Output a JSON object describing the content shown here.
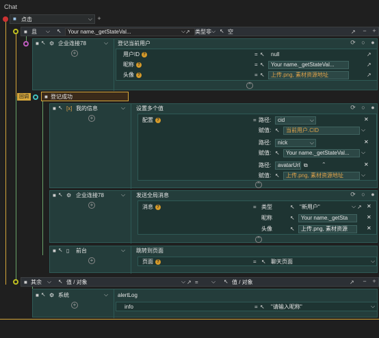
{
  "title": "Chat",
  "event": {
    "label": "点击"
  },
  "cond": {
    "keyword": "且",
    "left_value": "Your name._getStateVal...",
    "op": "类型非",
    "right_value": "空"
  },
  "enterprise1": {
    "name": "企业连接78",
    "action": "登记当前用户",
    "fields": [
      {
        "label": "用户ID",
        "value": "null"
      },
      {
        "label": "昵称",
        "value": "Your name._getStateVal..."
      },
      {
        "label": "头像",
        "value": "上传.png, 素材资源地址"
      }
    ]
  },
  "callback": {
    "tag": "回调",
    "label": "登记成功"
  },
  "myinfo": {
    "name": "我的信息",
    "action": "设置多个值",
    "config_label": "配置",
    "entries": [
      {
        "path_label": "路径:",
        "path": "cid",
        "assign_label": "赋值:",
        "value": "当前用户.CID"
      },
      {
        "path_label": "路径:",
        "path": "nick",
        "assign_label": "赋值:",
        "value": "Your name._getStateVal..."
      },
      {
        "path_label": "路径:",
        "path": "avatarUrl",
        "assign_label": "赋值:",
        "value": "上传.png, 素材资源地址"
      }
    ]
  },
  "enterprise2": {
    "name": "企业连接78",
    "action": "发送全局消息",
    "msg_label": "消息",
    "rows": [
      {
        "label": "类型",
        "value": "\"新用户\""
      },
      {
        "label": "昵称",
        "value": "Your name._getSta"
      },
      {
        "label": "头像",
        "value": "上传.png, 素材资源"
      }
    ]
  },
  "frontend": {
    "name": "前台",
    "action": "跳转到页面",
    "page_label": "页面",
    "page_value": "聊天页面"
  },
  "else_row": {
    "keyword": "其余",
    "left": "值 / 对象",
    "op": "=",
    "right": "值 / 对象"
  },
  "system": {
    "name": "系统",
    "action": "alertLog",
    "info_label": "info",
    "info_value": "\"请输入昵称\""
  }
}
